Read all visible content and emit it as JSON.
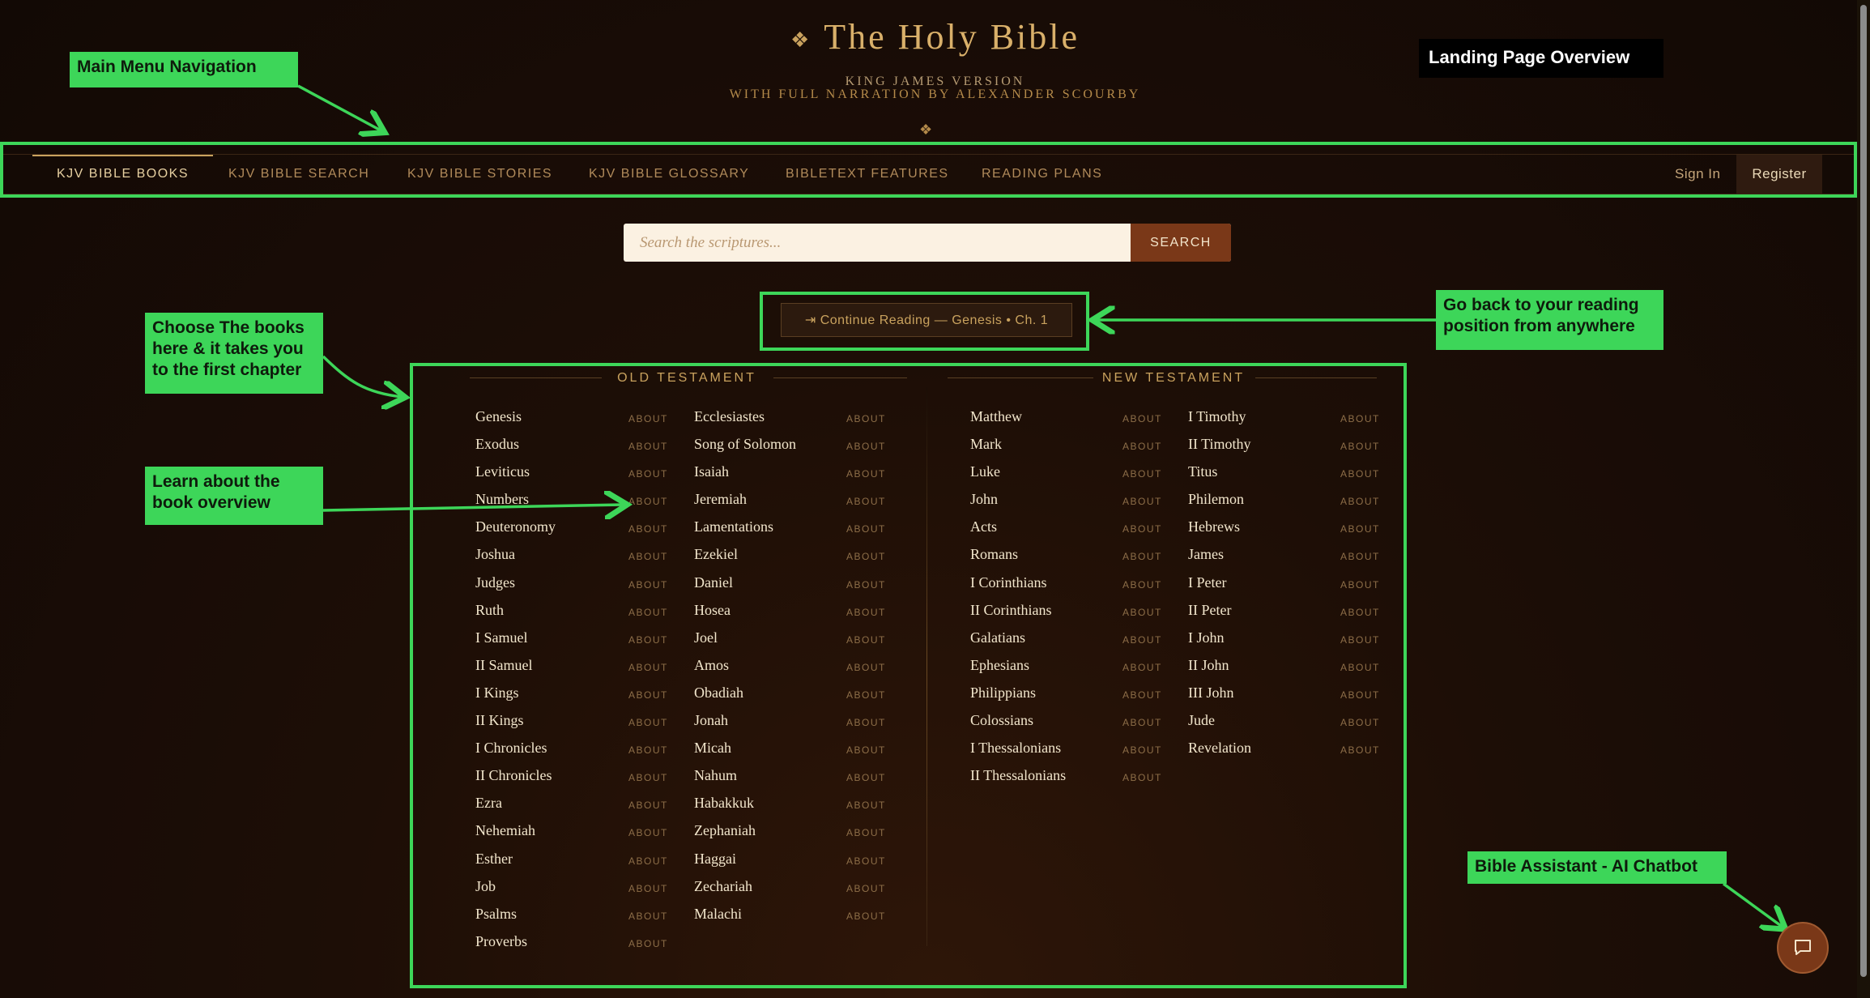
{
  "header": {
    "ornament": "❖",
    "title": "The Holy Bible",
    "subtitle_line1": "KING JAMES VERSION",
    "subtitle_line2": "WITH FULL NARRATION BY ALEXANDER SCOURBY",
    "divider_ornament": "❖"
  },
  "nav": {
    "items": [
      {
        "label": "KJV BIBLE BOOKS",
        "active": true
      },
      {
        "label": "KJV BIBLE SEARCH",
        "active": false
      },
      {
        "label": "KJV BIBLE STORIES",
        "active": false
      },
      {
        "label": "KJV BIBLE GLOSSARY",
        "active": false
      },
      {
        "label": "BIBLETEXT FEATURES",
        "active": false
      },
      {
        "label": "READING PLANS",
        "active": false
      }
    ],
    "sign_in": "Sign In",
    "register": "Register"
  },
  "search": {
    "placeholder": "Search the scriptures...",
    "button": "SEARCH"
  },
  "continue_reading": "⇥ Continue Reading — Genesis • Ch. 1",
  "about_label": "ABOUT",
  "old_testament": {
    "heading": "OLD TESTAMENT",
    "col1": [
      "Genesis",
      "Exodus",
      "Leviticus",
      "Numbers",
      "Deuteronomy",
      "Joshua",
      "Judges",
      "Ruth",
      "I Samuel",
      "II Samuel",
      "I Kings",
      "II Kings",
      "I Chronicles",
      "II Chronicles",
      "Ezra",
      "Nehemiah",
      "Esther",
      "Job",
      "Psalms",
      "Proverbs"
    ],
    "col2": [
      "Ecclesiastes",
      "Song of Solomon",
      "Isaiah",
      "Jeremiah",
      "Lamentations",
      "Ezekiel",
      "Daniel",
      "Hosea",
      "Joel",
      "Amos",
      "Obadiah",
      "Jonah",
      "Micah",
      "Nahum",
      "Habakkuk",
      "Zephaniah",
      "Haggai",
      "Zechariah",
      "Malachi"
    ]
  },
  "new_testament": {
    "heading": "NEW TESTAMENT",
    "col1": [
      "Matthew",
      "Mark",
      "Luke",
      "John",
      "Acts",
      "Romans",
      "I Corinthians",
      "II Corinthians",
      "Galatians",
      "Ephesians",
      "Philippians",
      "Colossians",
      "I Thessalonians",
      "II Thessalonians"
    ],
    "col2": [
      "I Timothy",
      "II Timothy",
      "Titus",
      "Philemon",
      "Hebrews",
      "James",
      "I Peter",
      "II Peter",
      "I John",
      "II John",
      "III John",
      "Jude",
      "Revelation"
    ]
  },
  "annotations": {
    "landing": "Landing Page Overview",
    "main_menu": "Main Menu Navigation",
    "choose_books": "Choose The books here & it takes you to the first chapter",
    "learn_about": "Learn about the book overview",
    "go_back": "Go back to your reading position from anywhere",
    "assistant": "Bible Assistant - AI Chatbot"
  },
  "colors": {
    "accent_gold": "#c9a25e",
    "annotation_green": "#3dd659",
    "button_rust": "#7a3818"
  },
  "icons": {
    "chat": "chat-bubble-icon",
    "ornament": "diamond-ornament-icon"
  }
}
